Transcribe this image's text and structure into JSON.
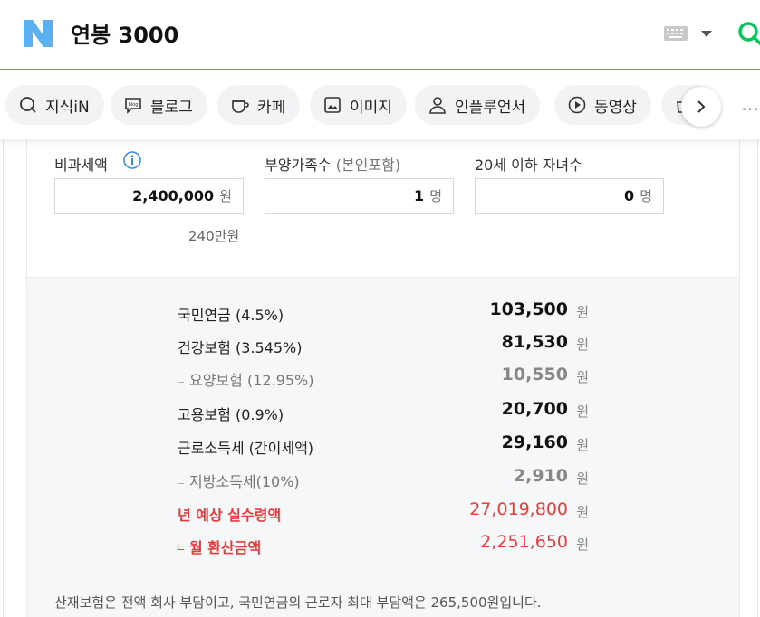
{
  "header": {
    "query": "연봉 3000",
    "brand_color": "#03c75a",
    "logo_color": "#5ab0f0"
  },
  "tabs": [
    {
      "label": "지식iN",
      "icon": "question-search-icon"
    },
    {
      "label": "블로그",
      "icon": "blog-icon"
    },
    {
      "label": "카페",
      "icon": "coffee-cup-icon"
    },
    {
      "label": "이미지",
      "icon": "image-icon"
    },
    {
      "label": "인플루언서",
      "icon": "person-icon"
    },
    {
      "label": "동영상",
      "icon": "play-icon"
    }
  ],
  "inputs": {
    "nontax": {
      "label": "비과세액",
      "value": "2,400,000",
      "unit": "원",
      "hint": "240만원"
    },
    "dependents": {
      "label": "부양가족수",
      "label_sub": "(본인포함)",
      "value": "1",
      "unit": "명"
    },
    "children": {
      "label": "20세 이하 자녀수",
      "value": "0",
      "unit": "명"
    }
  },
  "results": {
    "unit": "원",
    "rows": [
      {
        "label": "국민연금 (4.5%)",
        "amount": "103,500"
      },
      {
        "label": "건강보험 (3.545%)",
        "amount": "81,530"
      },
      {
        "label": "요양보험 (12.95%)",
        "amount": "10,550"
      },
      {
        "label": "고용보험 (0.9%)",
        "amount": "20,700"
      },
      {
        "label": "근로소득세 (간이세액)",
        "amount": "29,160"
      },
      {
        "label": "지방소득세(10%)",
        "amount": "2,910"
      },
      {
        "label": "년 예상 실수령액",
        "amount": "27,019,800"
      },
      {
        "label": "월 환산금액",
        "amount": "2,251,650"
      }
    ],
    "note": "산재보험은 전액 회사 부담이고, 국민연금의 근로자 최대 부담액은 265,500원입니다."
  },
  "colors": {
    "highlight_red": "#e73c3c",
    "panel_bg": "#f5f7f8"
  }
}
